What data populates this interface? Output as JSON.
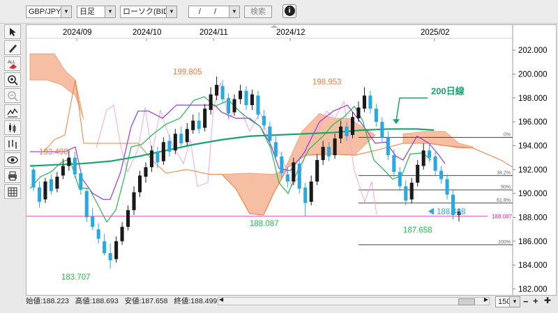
{
  "toolbar": {
    "pair": "GBP/JPY",
    "timeframe": "日足",
    "price_type": "ローソク(BID)",
    "date_value": "/ /",
    "search_label": "検索",
    "info_label": "i"
  },
  "chart": {
    "x_labels": [
      "2024/09",
      "2024/10",
      "2024/11",
      "2024/12",
      "2025/02"
    ],
    "y_labels": [
      "202.000",
      "200.000",
      "198.000",
      "196.000",
      "194.000",
      "192.000",
      "190.000",
      "188.000",
      "186.000",
      "184.000",
      "182.000"
    ],
    "annotations": {
      "high1": "199.805",
      "high2": "198.953",
      "left_level": "193.490",
      "low1": "183.707",
      "low2": "188.087",
      "low3": "187.658",
      "current_price": "188.498",
      "current_line": "188.087",
      "ma_label": "200日線"
    },
    "fib_levels": {
      "f0": "0%",
      "f38": "38.2%",
      "f50": "50%",
      "f61": "61.8%",
      "f100": "100%"
    },
    "colors": {
      "up": "#1a1a1a",
      "down": "#2aa9e0",
      "kumo": "#f6b99a",
      "ma200": "#18a36e",
      "purple": "#9b34d8",
      "pink": "#f3a6e0",
      "orange": "#f07d3b",
      "green": "#22b94c",
      "magenta": "#e21fb6"
    }
  },
  "status": {
    "open": "始値:188.223",
    "high": "高値:188.693",
    "low": "安値:187.658",
    "close": "終値:188.499"
  },
  "bottom": {
    "count": "150"
  }
}
